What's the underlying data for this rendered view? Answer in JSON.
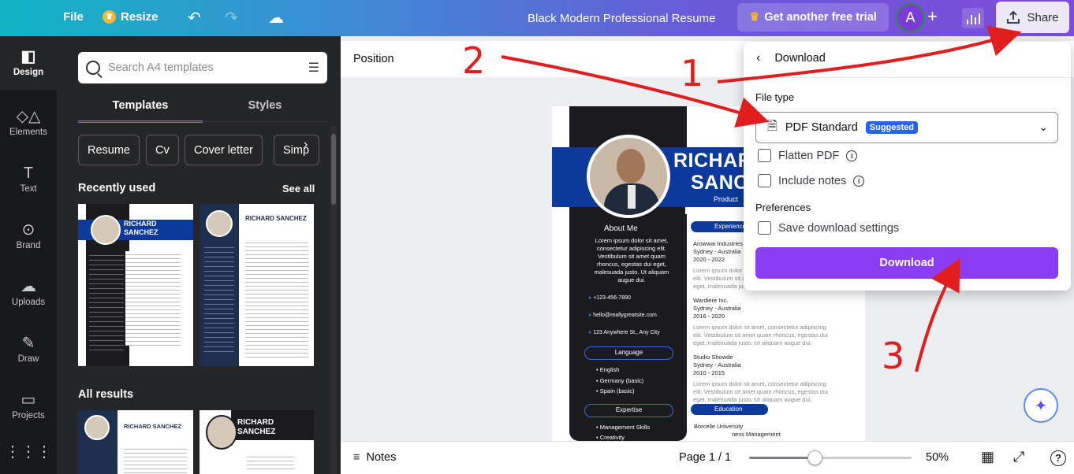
{
  "topbar": {
    "file": "File",
    "resize": "Resize",
    "doc_title": "Black Modern Professional Resume",
    "trial": "Get another free trial",
    "avatar_letter": "A",
    "share": "Share"
  },
  "rail": [
    {
      "label": "Design",
      "icon": "design-icon"
    },
    {
      "label": "Elements",
      "icon": "elements-icon"
    },
    {
      "label": "Text",
      "icon": "text-icon"
    },
    {
      "label": "Brand",
      "icon": "brand-icon"
    },
    {
      "label": "Uploads",
      "icon": "uploads-icon"
    },
    {
      "label": "Draw",
      "icon": "draw-icon"
    },
    {
      "label": "Projects",
      "icon": "projects-icon"
    }
  ],
  "panel": {
    "search_placeholder": "Search A4 templates",
    "tabs": [
      "Templates",
      "Styles"
    ],
    "chips": [
      "Resume",
      "Cv",
      "Cover letter",
      "Simp"
    ],
    "recent_title": "Recently used",
    "see_all": "See all",
    "all_results_title": "All results"
  },
  "canvas": {
    "position_label": "Position",
    "resume": {
      "name_line1": "RICHAR",
      "name_line2": "SANC",
      "role": "Product",
      "about_title": "About Me",
      "about_text": "Lorem ipsum dolor sit amet, consectetur adipiscing elit. Vestibulum sit amet quam rhoncus, egestas dui eget, malesuada justo. Ut aliquam augue dui.",
      "phone": "+123-456-7890",
      "email": "hello@reallygreatsite.com",
      "address": "123 Anywhere St., Any City",
      "language_title": "Language",
      "languages": [
        "English",
        "Germany (basic)",
        "Spain (basic)"
      ],
      "expertise_title": "Expertise",
      "expertise": [
        "Management Skills",
        "Creativity"
      ],
      "experience_title": "Experience",
      "jobs": [
        {
          "company": "Arowwai Industries",
          "place": "Sydney - Australia",
          "years": "2020 - 2022"
        },
        {
          "company": "Wardiere Inc.",
          "place": "Sydney - Australia",
          "years": "2016 - 2020"
        },
        {
          "company": "Studio Showde",
          "place": "Sydney - Australia",
          "years": "2010 - 2015"
        }
      ],
      "job_desc": "Lorem ipsum dolor sit amet, consectetur adipiscing elit. Vestibulum sit amet quam rhoncus, egestas dui eget, malesuada justo. Ut aliquam augue dui.",
      "education_title": "Education",
      "school": "Borcelle University",
      "degree": "ness Management"
    }
  },
  "bottombar": {
    "notes": "Notes",
    "page": "Page 1 / 1",
    "zoom": "50%",
    "zoom_fraction": 0.4
  },
  "download": {
    "title": "Download",
    "file_type_label": "File type",
    "file_type_value": "PDF Standard",
    "suggested": "Suggested",
    "flatten": "Flatten PDF",
    "include_notes": "Include notes",
    "preferences_label": "Preferences",
    "save_settings": "Save download settings",
    "button": "Download"
  },
  "thumbs": {
    "t1_name1": "RICHARD",
    "t1_name2": "SANCHEZ",
    "t2_name": "RICHARD SANCHEZ",
    "t3_name": "RICHARD SANCHEZ",
    "t4_name1": "RICHARD",
    "t4_name2": "SANCHEZ"
  },
  "annotations": [
    "1",
    "2",
    "3"
  ],
  "colors": {
    "accent": "#8b3df5",
    "resume_blue": "#0b3a9c",
    "annotation": "#e11e1e"
  }
}
